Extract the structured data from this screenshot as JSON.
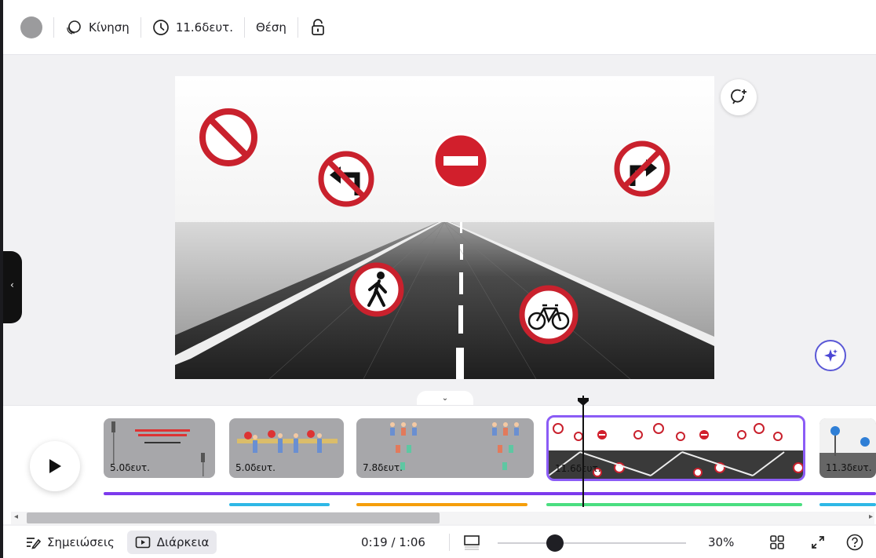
{
  "toolbar": {
    "color_swatch": "#9b9b9d",
    "animation_label": "Κίνηση",
    "duration_label": "11.6δευτ.",
    "position_label": "Θέση",
    "icons": [
      "animation-icon",
      "clock-icon",
      "lock-icon"
    ]
  },
  "canvas": {
    "signs": [
      "no-entry-circle-icon",
      "no-left-turn-icon",
      "no-entry-bar-icon",
      "no-right-turn-icon",
      "no-pedestrians-icon",
      "no-bicycles-icon"
    ],
    "actions": [
      "add-comment-icon",
      "magic-sparkle-icon"
    ]
  },
  "timeline": {
    "play_icon": "play-icon",
    "clips": [
      {
        "duration": "5.0δευτ."
      },
      {
        "duration": "5.0δευτ."
      },
      {
        "duration": "7.8δευτ."
      },
      {
        "duration": "11.6δευτ.",
        "selected": true
      },
      {
        "duration": "11.3δευτ."
      }
    ],
    "audio_color": "#7c3aed",
    "underline_colors": [
      "#2eb8e6",
      "#f59e0b",
      "#4ade80",
      "#2eb8e6"
    ]
  },
  "footer": {
    "notes_label": "Σημειώσεις",
    "duration_label": "Διάρκεια",
    "time": "0:19 / 1:06",
    "zoom": "30%",
    "icons": [
      "notes-icon",
      "duration-icon",
      "page-layout-icon",
      "grid-view-icon",
      "fullscreen-icon",
      "help-icon"
    ]
  }
}
